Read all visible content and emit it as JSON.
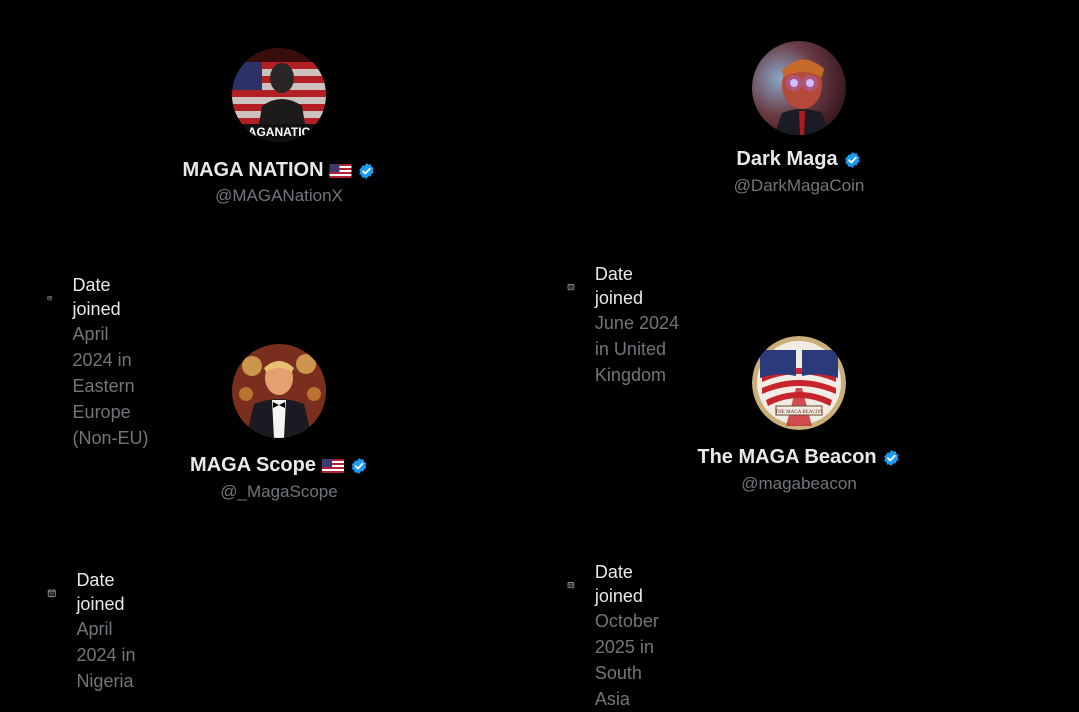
{
  "profiles": [
    {
      "name": "MAGA NATION",
      "handle": "@MAGANationX",
      "has_flag": true,
      "verified": true,
      "avatar_text": "AGANATIC",
      "date_joined_label": "Date joined",
      "date_joined_detail": "April 2024 in Eastern Europe (Non-EU)"
    },
    {
      "name": "Dark Maga",
      "handle": "@DarkMagaCoin",
      "has_flag": false,
      "verified": true,
      "date_joined_label": "Date joined",
      "date_joined_detail": "June 2024 in United Kingdom"
    },
    {
      "name": "MAGA Scope",
      "handle": "@_MagaScope",
      "has_flag": true,
      "verified": true,
      "date_joined_label": "Date joined",
      "date_joined_detail": "April 2024 in Nigeria"
    },
    {
      "name": "The MAGA Beacon",
      "handle": "@magabeacon",
      "has_flag": false,
      "verified": true,
      "avatar_text": "THE MAGA BEACON",
      "date_joined_label": "Date joined",
      "date_joined_detail": "October 2025 in South Asia"
    }
  ],
  "icons": {
    "verified": "verified-badge-icon",
    "calendar": "calendar-icon",
    "flag": "us-flag-icon"
  },
  "colors": {
    "background": "#000000",
    "primary_text": "#e7e9ea",
    "secondary_text": "#71767b",
    "verified_blue": "#1d9bf0"
  }
}
